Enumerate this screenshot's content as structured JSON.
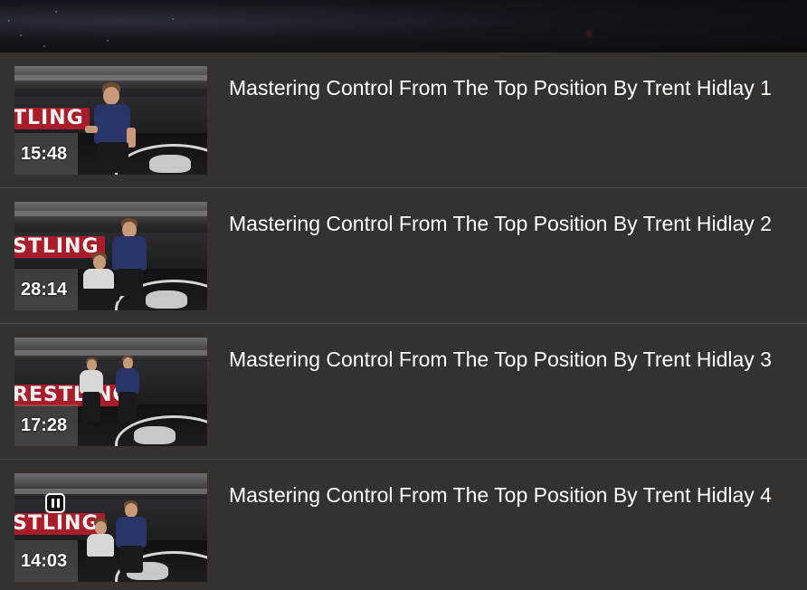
{
  "colors": {
    "background": "#34312f",
    "divider": "#4d4a47",
    "title_text": "#ffffff",
    "banner_red": "#a81d2a"
  },
  "videos": [
    {
      "title": "Mastering Control From The Top Position By Trent Hidlay 1",
      "duration": "15:48",
      "thumb_banner_text": "TLING",
      "playing": false
    },
    {
      "title": "Mastering Control From The Top Position By Trent Hidlay 2",
      "duration": "28:14",
      "thumb_banner_text": "STLING",
      "playing": false
    },
    {
      "title": "Mastering Control From The Top Position By Trent Hidlay 3",
      "duration": "17:28",
      "thumb_banner_text": "RESTLING",
      "playing": false
    },
    {
      "title": "Mastering Control From The Top Position By Trent Hidlay 4",
      "duration": "14:03",
      "thumb_banner_text": "STLING",
      "playing": true,
      "overlay_icon": "pause-icon"
    }
  ]
}
